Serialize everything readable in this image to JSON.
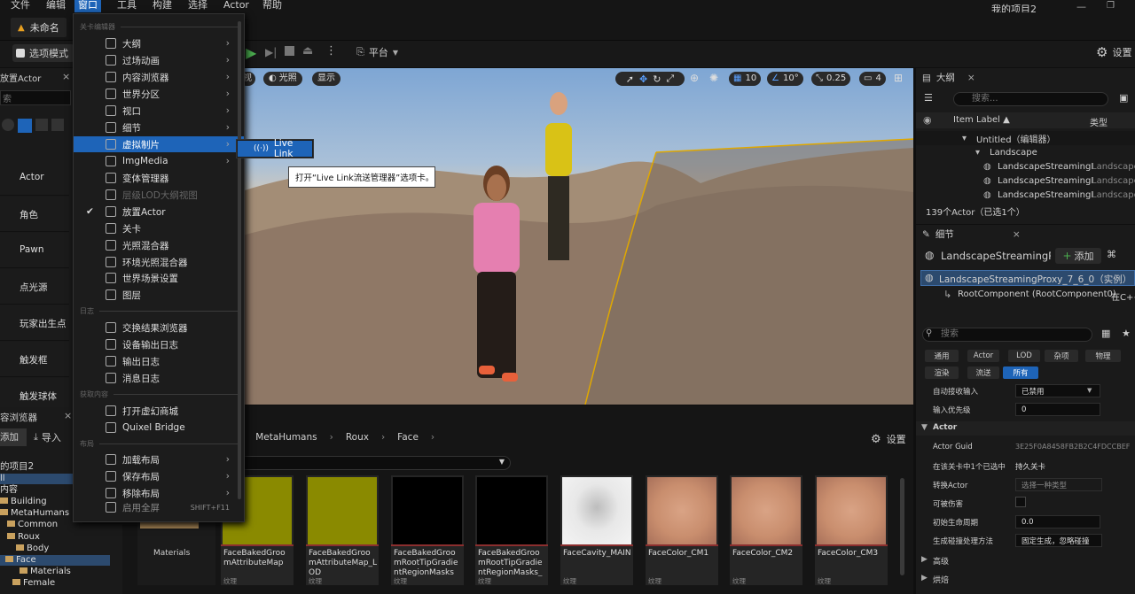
{
  "menubar": {
    "items": [
      "文件",
      "编辑",
      "窗口",
      "工具",
      "构建",
      "选择",
      "Actor",
      "帮助"
    ],
    "project": "我的项目2"
  },
  "tab": {
    "label": "未命名"
  },
  "toolbar": {
    "mode": "选项模式",
    "platform": "平台",
    "settings": "设置"
  },
  "viewport": {
    "view_label": "视",
    "lit_label": "光照",
    "show_label": "显示",
    "grid_value": "10",
    "angle_value": "10°",
    "scale_value": "0.25",
    "cam_value": "4"
  },
  "left_panel": {
    "title": "放置Actor",
    "search_placeholder": "索",
    "items": [
      "Actor",
      "角色",
      "Pawn",
      "点光源",
      "玩家出生点",
      "触发框",
      "触发球体"
    ]
  },
  "content_browser": {
    "title": "容浏览器",
    "add": "添加",
    "import": "导入",
    "root": "的项目2",
    "tree": [
      "ll",
      "内容",
      "Building",
      "MetaHumans",
      "Common",
      "Roux",
      "Body",
      "Face",
      "Materials",
      "Female"
    ],
    "breadcrumb": [
      "MetaHumans",
      "Roux",
      "Face"
    ],
    "settings": "设置",
    "folder": "Materials",
    "assets": [
      {
        "name": "FaceBakedGroomAttributeMap",
        "type": "纹理",
        "color": "#8a8a00"
      },
      {
        "name": "FaceBakedGroomAttributeMap_LOD",
        "type": "纹理",
        "color": "#8a8a00"
      },
      {
        "name": "FaceBakedGroomRootTipGradientRegionMasks",
        "type": "纹理",
        "color": "#000000"
      },
      {
        "name": "FaceBakedGroomRootTipGradientRegionMasks_",
        "type": "纹理",
        "color": "#000000"
      },
      {
        "name": "FaceCavity_MAIN",
        "type": "纹理",
        "color": "#e8e8e8"
      },
      {
        "name": "FaceColor_CM1",
        "type": "纹理",
        "color": "#c98e6e"
      },
      {
        "name": "FaceColor_CM2",
        "type": "纹理",
        "color": "#c98e6e"
      },
      {
        "name": "FaceColor_CM3",
        "type": "纹理",
        "color": "#c98e6e"
      }
    ]
  },
  "dropdown": {
    "section1": "关卡编辑器",
    "items1": [
      "大纲",
      "过场动画",
      "内容浏览器",
      "世界分区",
      "视口",
      "细节",
      "虚拟制片",
      "ImgMedia",
      "变体管理器",
      "层级LOD大纲视图",
      "放置Actor",
      "关卡",
      "光照混合器",
      "环境光照混合器",
      "世界场景设置",
      "图层"
    ],
    "section2": "日志",
    "items2": [
      "交换结果浏览器",
      "设备输出日志",
      "输出日志",
      "消息日志"
    ],
    "section3": "获取内容",
    "items3": [
      "打开虚幻商城",
      "Quixel Bridge"
    ],
    "section4": "布局",
    "items4": [
      "加载布局",
      "保存布局",
      "移除布局",
      "启用全屏"
    ],
    "shortcut": "SHIFT+F11",
    "submenu_item": "Live Link",
    "tooltip": "打开“Live Link流送管理器”选项卡。"
  },
  "outliner": {
    "title": "大纲",
    "search_placeholder": "搜索...",
    "col_label": "Item Label ▲",
    "col_type": "类型",
    "rows": [
      {
        "label": "Untitled（编辑器）",
        "type": ""
      },
      {
        "label": "Landscape",
        "type": ""
      },
      {
        "label": "LandscapeStreamingF",
        "type": "Landscape"
      },
      {
        "label": "LandscapeStreamingF",
        "type": "Landscape"
      },
      {
        "label": "LandscapeStreamingF",
        "type": "Landscape"
      }
    ],
    "status": "139个Actor（已选1个）"
  },
  "details": {
    "title": "细节",
    "object_name": "LandscapeStreamingPr",
    "add": "添加",
    "instance": "LandscapeStreamingProxy_7_6_0（实例）",
    "root_component": "RootComponent (RootComponent0)",
    "root_component_type": "在C++",
    "search_placeholder": "搜索",
    "filters": [
      "通用",
      "Actor",
      "LOD",
      "杂项",
      "物理",
      "渲染",
      "流送",
      "所有"
    ],
    "props": [
      {
        "name": "自动接收输入",
        "value": "已禁用"
      },
      {
        "name": "输入优先级",
        "value": "0"
      }
    ],
    "actor_section": "Actor",
    "actor_props": [
      {
        "name": "Actor Guid",
        "value": "3E25F0A8458FB2B2C4FDCCBEF"
      },
      {
        "name": "在该关卡中1个已选中",
        "value": "持久关卡"
      },
      {
        "name": "转换Actor",
        "value": "选择一种类型"
      },
      {
        "name": "可被伤害",
        "value": ""
      },
      {
        "name": "初始生命周期",
        "value": "0.0"
      },
      {
        "name": "生成碰撞处理方法",
        "value": "固定生成，忽略碰撞"
      }
    ],
    "sections": [
      "高级",
      "烘焙"
    ]
  }
}
